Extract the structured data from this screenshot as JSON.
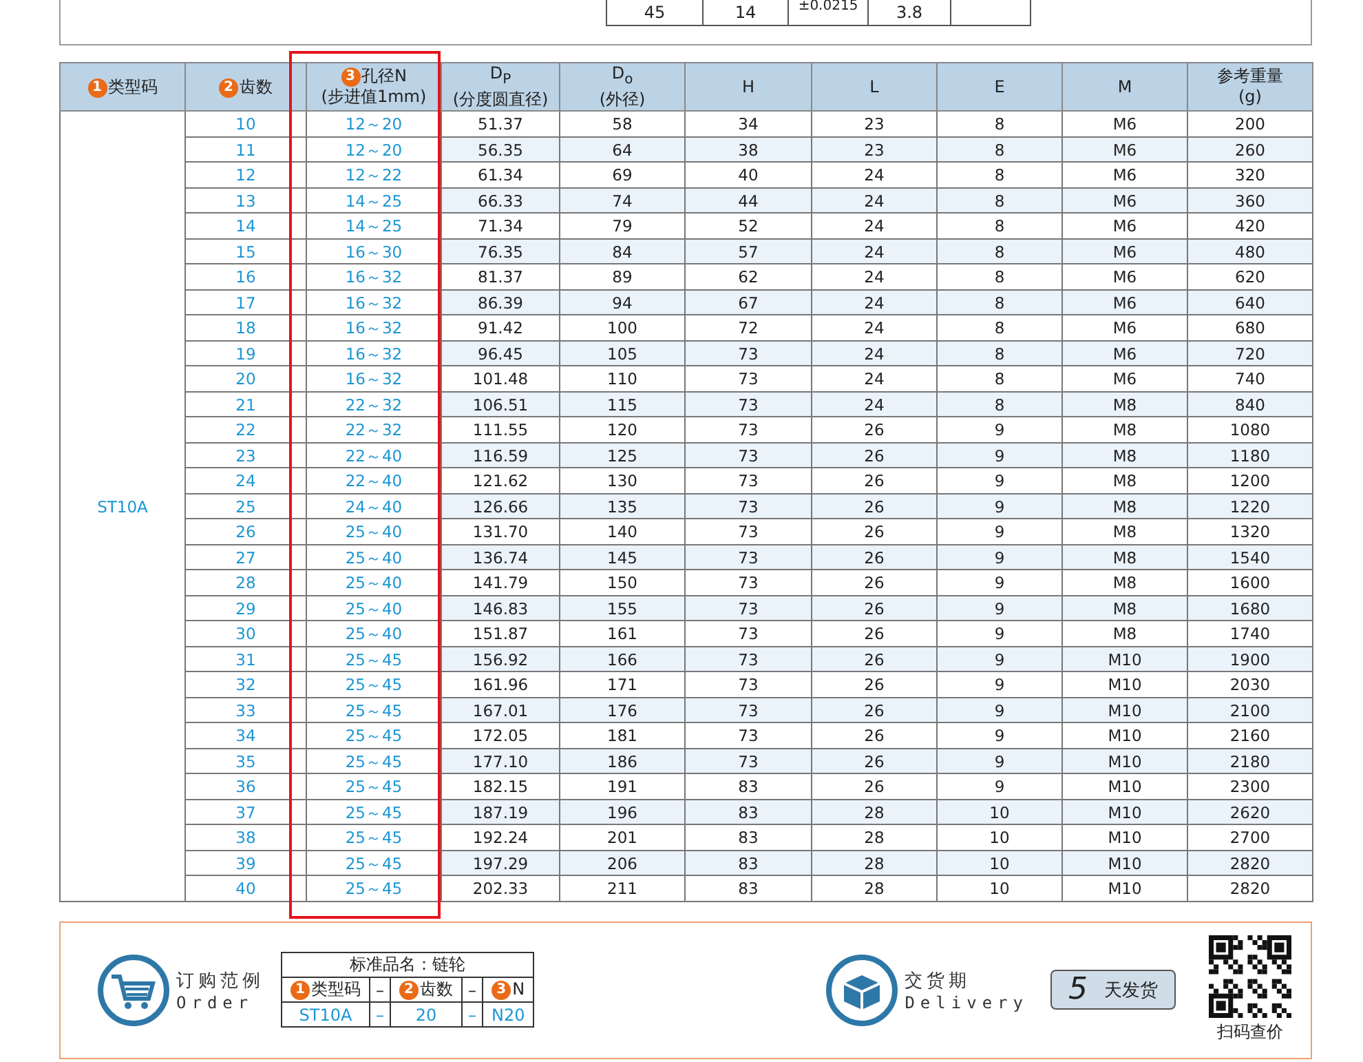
{
  "top_fragment": {
    "cells": [
      "45",
      "14",
      "±0.0215",
      "3.8"
    ]
  },
  "table": {
    "columns": [
      {
        "badge": "1",
        "label": "类型码"
      },
      {
        "badge": "2",
        "label": "齿数"
      },
      {
        "badge": "3",
        "label": "孔径N",
        "sub": "(步进值1mm)",
        "highlighted": true
      },
      {
        "label": "D$_{P}$",
        "sub": "(分度圆直径)"
      },
      {
        "label": "D$_{o}$",
        "sub": "(外径)"
      },
      {
        "label": "H"
      },
      {
        "label": "L"
      },
      {
        "label": "E"
      },
      {
        "label": "M"
      },
      {
        "label": "参考重量",
        "sub": "(g)"
      }
    ],
    "rows": [
      [
        {
          "text": "ST10A",
          "rowspan": 31
        },
        "10",
        "12～20",
        "51.37",
        "58",
        "34",
        "23",
        "8",
        "M6",
        "200"
      ],
      [
        "11",
        "12～20",
        "56.35",
        "64",
        "38",
        "23",
        "8",
        "M6",
        "260"
      ],
      [
        "12",
        "12～22",
        "61.34",
        "69",
        "40",
        "24",
        "8",
        "M6",
        "320"
      ],
      [
        "13",
        "14～25",
        "66.33",
        "74",
        "44",
        "24",
        "8",
        "M6",
        "360"
      ],
      [
        "14",
        "14～25",
        "71.34",
        "79",
        "52",
        "24",
        "8",
        "M6",
        "420"
      ],
      [
        "15",
        "16～30",
        "76.35",
        "84",
        "57",
        "24",
        "8",
        "M6",
        "480"
      ],
      [
        "16",
        "16～32",
        "81.37",
        "89",
        "62",
        "24",
        "8",
        "M6",
        "620"
      ],
      [
        "17",
        "16～32",
        "86.39",
        "94",
        "67",
        "24",
        "8",
        "M6",
        "640"
      ],
      [
        "18",
        "16～32",
        "91.42",
        "100",
        "72",
        "24",
        "8",
        "M6",
        "680"
      ],
      [
        "19",
        "16～32",
        "96.45",
        "105",
        "73",
        "24",
        "8",
        "M6",
        "720"
      ],
      [
        "20",
        "16～32",
        "101.48",
        "110",
        "73",
        "24",
        "8",
        "M6",
        "740"
      ],
      [
        "21",
        "22～32",
        "106.51",
        "115",
        "73",
        "24",
        "8",
        "M8",
        "840"
      ],
      [
        "22",
        "22～32",
        "111.55",
        "120",
        "73",
        "26",
        "9",
        "M8",
        "1080"
      ],
      [
        "23",
        "22～40",
        "116.59",
        "125",
        "73",
        "26",
        "9",
        "M8",
        "1180"
      ],
      [
        "24",
        "22～40",
        "121.62",
        "130",
        "73",
        "26",
        "9",
        "M8",
        "1200"
      ],
      [
        "25",
        "24～40",
        "126.66",
        "135",
        "73",
        "26",
        "9",
        "M8",
        "1220"
      ],
      [
        "26",
        "25～40",
        "131.70",
        "140",
        "73",
        "26",
        "9",
        "M8",
        "1320"
      ],
      [
        "27",
        "25～40",
        "136.74",
        "145",
        "73",
        "26",
        "9",
        "M8",
        "1540"
      ],
      [
        "28",
        "25～40",
        "141.79",
        "150",
        "73",
        "26",
        "9",
        "M8",
        "1600"
      ],
      [
        "29",
        "25～40",
        "146.83",
        "155",
        "73",
        "26",
        "9",
        "M8",
        "1680"
      ],
      [
        "30",
        "25～40",
        "151.87",
        "161",
        "73",
        "26",
        "9",
        "M8",
        "1740"
      ],
      [
        "31",
        "25～45",
        "156.92",
        "166",
        "73",
        "26",
        "9",
        "M10",
        "1900"
      ],
      [
        "32",
        "25～45",
        "161.96",
        "171",
        "73",
        "26",
        "9",
        "M10",
        "2030"
      ],
      [
        "33",
        "25～45",
        "167.01",
        "176",
        "73",
        "26",
        "9",
        "M10",
        "2100"
      ],
      [
        "34",
        "25～45",
        "172.05",
        "181",
        "73",
        "26",
        "9",
        "M10",
        "2160"
      ],
      [
        "35",
        "25～45",
        "177.10",
        "186",
        "73",
        "26",
        "9",
        "M10",
        "2180"
      ],
      [
        "36",
        "25～45",
        "182.15",
        "191",
        "83",
        "26",
        "9",
        "M10",
        "2300"
      ],
      [
        "37",
        "25～45",
        "187.19",
        "196",
        "83",
        "28",
        "10",
        "M10",
        "2620"
      ],
      [
        "38",
        "25～45",
        "192.24",
        "201",
        "83",
        "28",
        "10",
        "M10",
        "2700"
      ],
      [
        "39",
        "25～45",
        "197.29",
        "206",
        "83",
        "28",
        "10",
        "M10",
        "2820"
      ],
      [
        "40",
        "25～45",
        "202.33",
        "211",
        "83",
        "28",
        "10",
        "M10",
        "2820"
      ]
    ]
  },
  "order_example": {
    "title": "订购范例",
    "subtitle": "Order",
    "table_title": "标准品名：链轮",
    "headers": [
      {
        "badge": "1",
        "label": "类型码"
      },
      {
        "label": "–"
      },
      {
        "badge": "2",
        "label": "齿数"
      },
      {
        "label": "–"
      },
      {
        "badge": "3",
        "label": "N"
      }
    ],
    "values": [
      "ST10A",
      "–",
      "20",
      "–",
      "N20"
    ]
  },
  "delivery": {
    "title": "交货期",
    "subtitle": "Delivery",
    "days": "5",
    "days_label": "天发货"
  },
  "qr": {
    "caption": "扫码查价"
  }
}
